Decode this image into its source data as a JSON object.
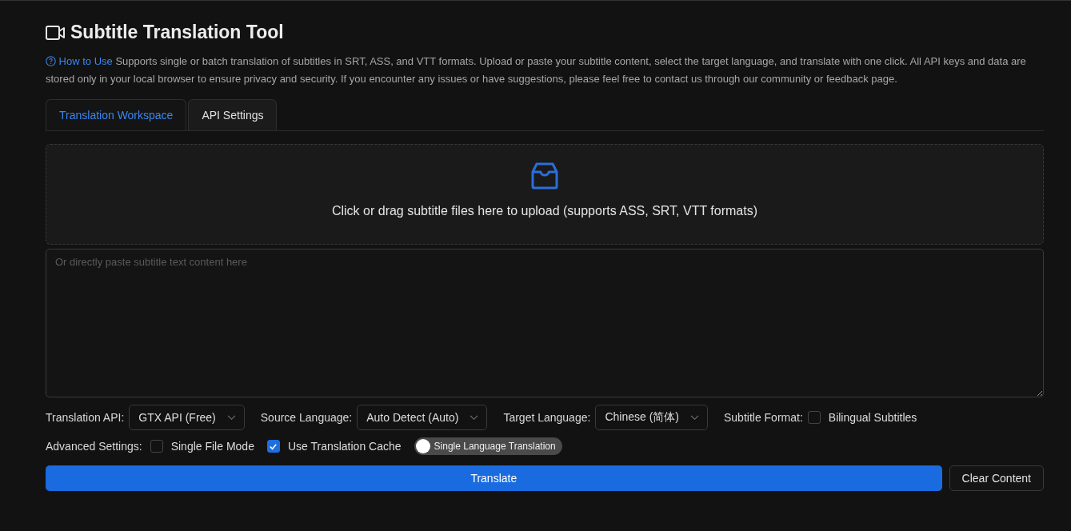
{
  "title": "Subtitle Translation Tool",
  "intro": {
    "link": "How to Use",
    "text": "Supports single or batch translation of subtitles in SRT, ASS, and VTT formats. Upload or paste your subtitle content, select the target language, and translate with one click. All API keys and data are stored only in your local browser to ensure privacy and security. If you encounter any issues or have suggestions, please feel free to contact us through our community or feedback page."
  },
  "tabs": [
    {
      "label": "Translation Workspace",
      "selected": true
    },
    {
      "label": "API Settings",
      "selected": false
    }
  ],
  "upload": {
    "text": "Click or drag subtitle files here to upload (supports ASS, SRT, VTT formats)"
  },
  "paste": {
    "placeholder": "Or directly paste subtitle text content here"
  },
  "selects": [
    {
      "label": "Translation API:",
      "value": "GTX API (Free)"
    },
    {
      "label": "Source Language:",
      "value": "Auto Detect (Auto)"
    },
    {
      "label": "Target Language:",
      "value": "Chinese (简体)"
    }
  ],
  "subtitle_format": {
    "label": "Subtitle Format:",
    "option": {
      "label": "Bilingual Subtitles",
      "checked": false
    }
  },
  "advanced": {
    "label": "Advanced Settings:",
    "options": [
      {
        "label": "Single File Mode",
        "checked": false
      },
      {
        "label": "Use Translation Cache",
        "checked": true
      }
    ],
    "switch": {
      "label": "Single Language Translation",
      "on": false
    }
  },
  "buttons": {
    "primary": "Translate",
    "secondary": "Clear Content"
  }
}
